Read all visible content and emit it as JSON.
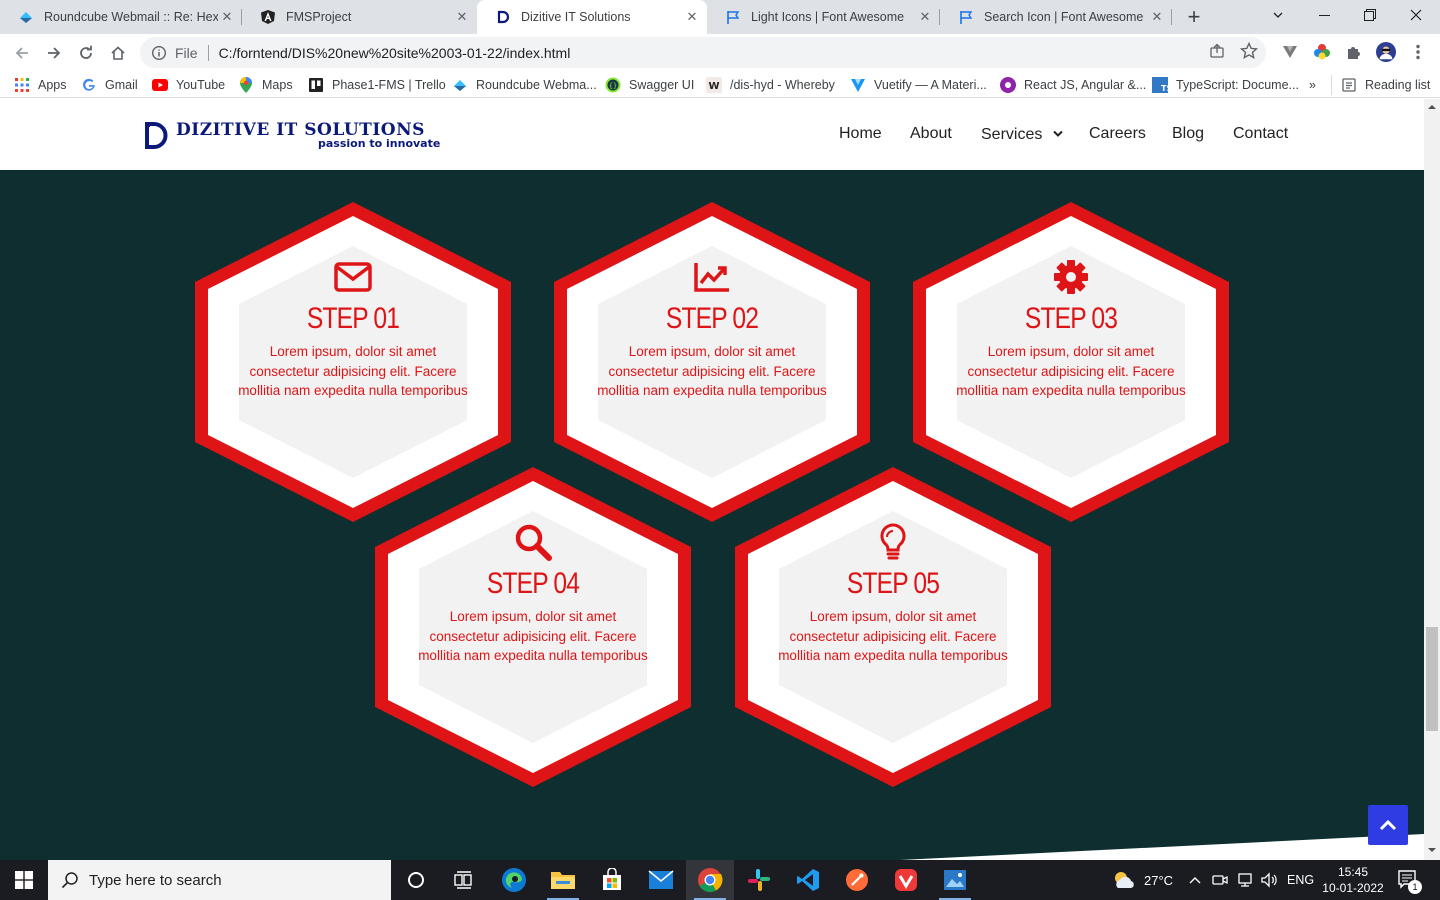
{
  "browser": {
    "tabs": [
      {
        "title": "Roundcube Webmail :: Re: Hexa",
        "icon": "roundcube-icon"
      },
      {
        "title": "FMSProject",
        "icon": "angular-icon"
      },
      {
        "title": "Dizitive IT Solutions",
        "icon": "dizitive-icon"
      },
      {
        "title": "Light Icons | Font Awesome",
        "icon": "flag-icon"
      },
      {
        "title": "Search Icon | Font Awesome",
        "icon": "flag-icon"
      }
    ],
    "address": {
      "scheme": "File",
      "url": "C:/forntend/DIS%20new%20site%2003-01-22/index.html"
    },
    "bookmarks": [
      {
        "label": "Apps"
      },
      {
        "label": "Gmail"
      },
      {
        "label": "YouTube"
      },
      {
        "label": "Maps"
      },
      {
        "label": "Phase1-FMS | Trello"
      },
      {
        "label": "Roundcube Webma..."
      },
      {
        "label": "Swagger UI"
      },
      {
        "label": "/dis-hyd - Whereby"
      },
      {
        "label": "Vuetify — A Materi..."
      },
      {
        "label": "React JS, Angular &..."
      },
      {
        "label": "TypeScript: Docume..."
      }
    ],
    "more_bookmarks": "»",
    "reading_list": "Reading list"
  },
  "site": {
    "logo_name": "DIZITIVE IT SOLUTIONS",
    "logo_tagline": "passion to innovate",
    "nav": [
      "Home",
      "About",
      "Services",
      "Careers",
      "Blog",
      "Contact"
    ],
    "steps": [
      {
        "title": "STEP 01",
        "text": "Lorem ipsum, dolor sit amet consectetur adipisicing elit. Facere mollitia nam expedita nulla temporibus",
        "icon": "envelope-icon"
      },
      {
        "title": "STEP 02",
        "text": "Lorem ipsum, dolor sit amet consectetur adipisicing elit. Facere mollitia nam expedita nulla temporibus",
        "icon": "chart-line-icon"
      },
      {
        "title": "STEP 03",
        "text": "Lorem ipsum, dolor sit amet consectetur adipisicing elit. Facere mollitia nam expedita nulla temporibus",
        "icon": "gear-icon"
      },
      {
        "title": "STEP 04",
        "text": "Lorem ipsum, dolor sit amet consectetur adipisicing elit. Facere mollitia nam expedita nulla temporibus",
        "icon": "search-icon"
      },
      {
        "title": "STEP 05",
        "text": "Lorem ipsum, dolor sit amet consectetur adipisicing elit. Facere mollitia nam expedita nulla temporibus",
        "icon": "lightbulb-icon"
      }
    ],
    "colors": {
      "accent": "#df1416",
      "background": "#0e2e2f",
      "brand": "#0b1a7a",
      "button": "#2f3be3"
    }
  },
  "taskbar": {
    "search_placeholder": "Type here to search",
    "weather": "27°C",
    "language": "ENG",
    "time": "15:45",
    "date": "10-01-2022",
    "notification_count": "1"
  }
}
